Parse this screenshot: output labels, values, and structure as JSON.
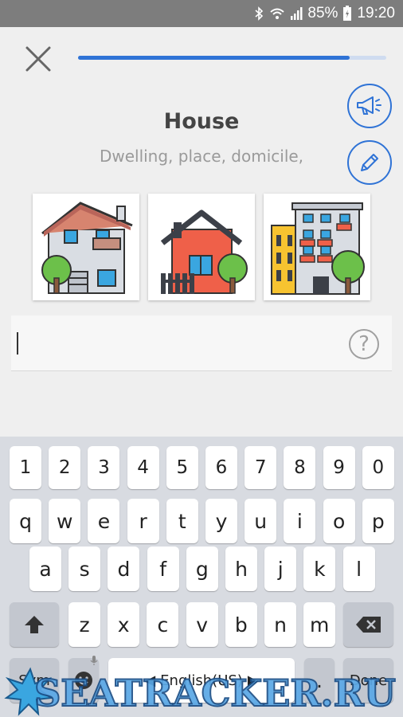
{
  "status_bar": {
    "battery": "85%",
    "time": "19:20"
  },
  "lesson": {
    "progress_fraction": 0.88,
    "word": "House",
    "synonyms": "Dwelling, place, domicile,"
  },
  "images": [
    {
      "name": "two-storey-house"
    },
    {
      "name": "red-cottage"
    },
    {
      "name": "apartment-building"
    }
  ],
  "answer": {
    "value": ""
  },
  "help": {
    "label": "?"
  },
  "keyboard": {
    "row_numbers": [
      "1",
      "2",
      "3",
      "4",
      "5",
      "6",
      "7",
      "8",
      "9",
      "0"
    ],
    "row1": [
      "q",
      "w",
      "e",
      "r",
      "t",
      "y",
      "u",
      "i",
      "o",
      "p"
    ],
    "row2": [
      "a",
      "s",
      "d",
      "f",
      "g",
      "h",
      "j",
      "k",
      "l"
    ],
    "row3": [
      "z",
      "x",
      "c",
      "v",
      "b",
      "n",
      "m"
    ],
    "sym": "Sym",
    "language": "English(US)",
    "done": "Done"
  },
  "watermark": "SEATRACKER.RU",
  "colors": {
    "accent": "#2f73d6",
    "status_bar": "#7d7d7d",
    "keyboard_bg": "#d8dbe1"
  }
}
